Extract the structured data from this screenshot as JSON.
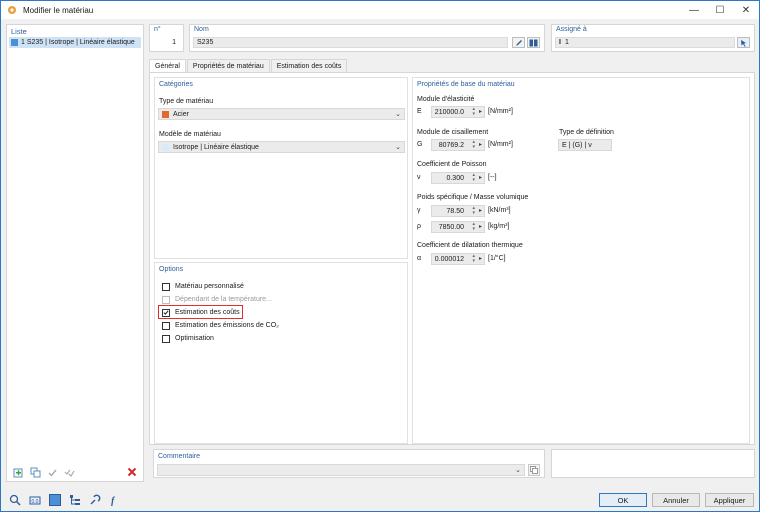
{
  "window": {
    "title": "Modifier le matériau",
    "minimize": "—",
    "maximize": "☐",
    "close": "✕"
  },
  "list": {
    "header": "Liste",
    "items": [
      {
        "text": "1  S235 | Isotrope | Linéaire élastique"
      }
    ]
  },
  "header": {
    "num_label": "n°",
    "num_value": "1",
    "name_label": "Nom",
    "name_value": "S235",
    "assigned_label": "Assigné à",
    "assigned_value": "1"
  },
  "tabs": [
    "Général",
    "Propriétés de matériau",
    "Estimation des coûts"
  ],
  "categories": {
    "title": "Catégories",
    "type_label": "Type de matériau",
    "type_value": "Acier",
    "type_color": "#e06a2b",
    "model_label": "Modèle de matériau",
    "model_value": "Isotrope | Linéaire élastique",
    "model_color": "#d7ecf8"
  },
  "options": {
    "title": "Options",
    "items": [
      {
        "label": "Matériau personnalisé",
        "checked": false,
        "disabled": false
      },
      {
        "label": "Dépendant de la température...",
        "checked": false,
        "disabled": true
      },
      {
        "label": "Estimation des coûts",
        "checked": true,
        "disabled": false
      },
      {
        "label": "Estimation des émissions de CO₂",
        "checked": false,
        "disabled": false
      },
      {
        "label": "Optimisation",
        "checked": false,
        "disabled": false
      }
    ]
  },
  "props": {
    "title": "Propriétés de base du matériau",
    "elasticity_label": "Module d'élasticité",
    "E_sym": "E",
    "E_value": "210000.0",
    "E_unit": "[N/mm²]",
    "shear_label": "Module de cisaillement",
    "G_sym": "G",
    "G_value": "80769.2",
    "G_unit": "[N/mm²]",
    "def_type_label": "Type de définition",
    "def_type_value": "E | (G) | ν",
    "poisson_label": "Coefficient de Poisson",
    "nu_sym": "ν",
    "nu_value": "0.300",
    "nu_unit": "[--]",
    "weight_label": "Poids spécifique / Masse volumique",
    "gamma_sym": "γ",
    "gamma_value": "78.50",
    "gamma_unit": "[kN/m³]",
    "rho_sym": "ρ",
    "rho_value": "7850.00",
    "rho_unit": "[kg/m³]",
    "thermal_label": "Coefficient de dilatation thermique",
    "alpha_sym": "α",
    "alpha_value": "0.000012",
    "alpha_unit": "[1/°C]"
  },
  "comment": {
    "label": "Commentaire",
    "value": ""
  },
  "buttons": {
    "ok": "OK",
    "cancel": "Annuler",
    "apply": "Appliquer"
  },
  "icons": {
    "list_tools": [
      "add-icon",
      "copy-icon",
      "check-icon",
      "check-all-icon",
      "delete-icon"
    ],
    "footer_tools": [
      "search-icon",
      "units-icon",
      "color-icon",
      "tree-icon",
      "help-icon",
      "function-icon"
    ]
  },
  "colors": {
    "accent": "#2b79c2",
    "header_text": "#2d5e9c",
    "highlight": "#e0302a"
  }
}
